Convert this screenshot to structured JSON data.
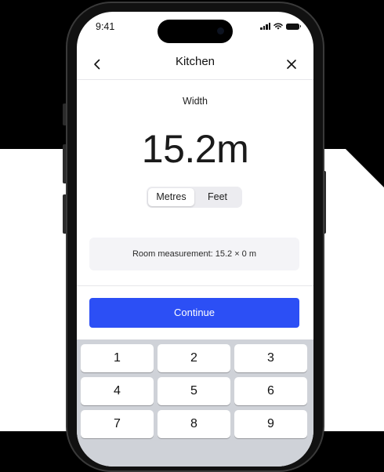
{
  "status_bar": {
    "time": "9:41",
    "icons": [
      "cellular-signal-icon",
      "wifi-icon",
      "battery-icon"
    ]
  },
  "nav": {
    "title": "Kitchen",
    "back_icon": "chevron-left-icon",
    "close_icon": "close-icon"
  },
  "measurement": {
    "label": "Width",
    "value": "15.2m"
  },
  "unit_toggle": {
    "options": [
      {
        "label": "Metres",
        "selected": true
      },
      {
        "label": "Feet",
        "selected": false
      }
    ]
  },
  "summary": {
    "text": "Room measurement: 15.2 × 0 m"
  },
  "continue_label": "Continue",
  "keypad": {
    "keys": [
      "1",
      "2",
      "3",
      "4",
      "5",
      "6",
      "7",
      "8",
      "9"
    ]
  },
  "colors": {
    "accent": "#2c4ff5",
    "keypad_bg": "#cfd2d8",
    "frame": "#111111"
  }
}
